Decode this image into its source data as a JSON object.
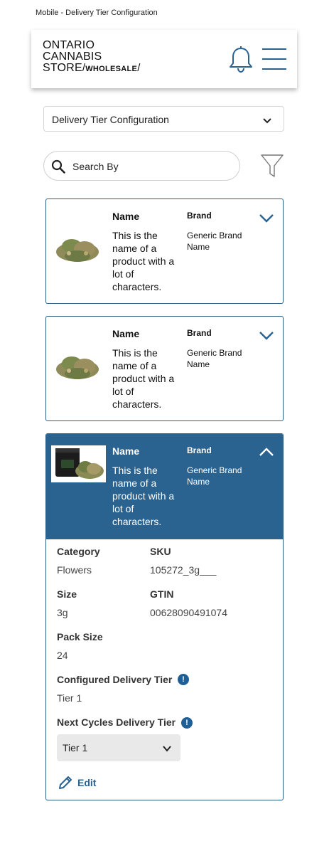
{
  "frame_label": "Mobile - Delivery Tier Configuration",
  "header": {
    "logo_line1": "ONTARIO",
    "logo_line2": "CANNABIS",
    "logo_line3": "STORE",
    "logo_wholesale": "WHOLESALE",
    "icons": [
      "bell-icon",
      "hamburger-menu-icon"
    ]
  },
  "page_select": {
    "selected": "Delivery Tier Configuration"
  },
  "search": {
    "placeholder": "Search By"
  },
  "colors": {
    "primary": "#2a6290",
    "border": "#2a5d85",
    "info": "#1f5f95"
  },
  "cards": [
    {
      "name_label": "Name",
      "name_value": "This is the name of a product with a lot of characters.",
      "brand_label": "Brand",
      "brand_value": "Generic Brand Name",
      "expanded": false
    },
    {
      "name_label": "Name",
      "name_value": "This is the name of a product with a lot of characters.",
      "brand_label": "Brand",
      "brand_value": "Generic Brand Name",
      "expanded": false
    },
    {
      "name_label": "Name",
      "name_value": "This is the name of a product with a lot of characters.",
      "brand_label": "Brand",
      "brand_value": "Generic Brand Name",
      "expanded": true,
      "details": {
        "category_label": "Category",
        "category_value": "Flowers",
        "sku_label": "SKU",
        "sku_value": "105272_3g___",
        "size_label": "Size",
        "size_value": "3g",
        "gtin_label": "GTIN",
        "gtin_value": "00628090491074",
        "pack_size_label": "Pack Size",
        "pack_size_value": "24",
        "configured_tier_label": "Configured Delivery Tier",
        "configured_tier_value": "Tier 1",
        "next_tier_label": "Next Cycles Delivery Tier",
        "next_tier_selected": "Tier 1",
        "info_glyph": "!",
        "edit_label": "Edit"
      }
    }
  ]
}
